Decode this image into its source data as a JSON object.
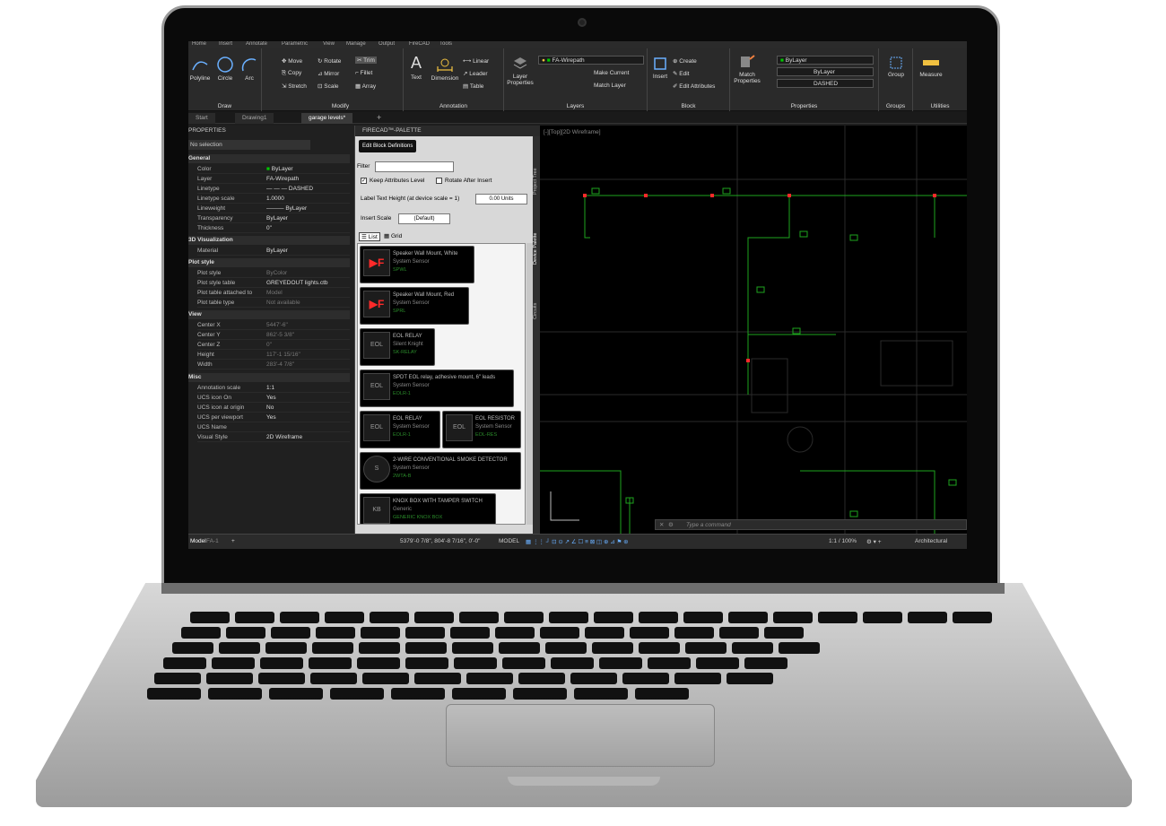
{
  "ribbon": {
    "tabs": [
      "Home",
      "Insert",
      "Annotate",
      "Parametric",
      "View",
      "Manage",
      "Output",
      "FireCAD",
      "Tools"
    ],
    "draw": {
      "label": "Draw",
      "polyline": "Polyline",
      "circle": "Circle",
      "arc": "Arc"
    },
    "modify": {
      "label": "Modify",
      "move": "Move",
      "rotate": "Rotate",
      "trim": "Trim",
      "copy": "Copy",
      "mirror": "Mirror",
      "fillet": "Fillet",
      "stretch": "Stretch",
      "scale": "Scale",
      "array": "Array"
    },
    "annotation": {
      "label": "Annotation",
      "text": "Text",
      "dimension": "Dimension",
      "linear": "Linear",
      "leader": "Leader",
      "table": "Table"
    },
    "layers": {
      "label": "Layers",
      "layer_properties": "Layer Properties",
      "current_layer": "FA-Wirepath",
      "make_current": "Make Current",
      "match_layer": "Match Layer"
    },
    "block": {
      "label": "Block",
      "insert": "Insert",
      "create": "Create",
      "edit": "Edit",
      "edit_attributes": "Edit Attributes"
    },
    "properties": {
      "label": "Properties",
      "match_properties": "Match Properties",
      "color": "ByLayer",
      "lineweight": "ByLayer",
      "linetype": "DASHED"
    },
    "groups": {
      "label": "Groups",
      "group": "Group"
    },
    "utilities": {
      "label": "Utilities",
      "measure": "Measure"
    }
  },
  "doc_tabs": [
    "Start",
    "Drawing1",
    "garage levels*"
  ],
  "props": {
    "title": "PROPERTIES",
    "selection": "No selection",
    "sections": {
      "general": "General",
      "viz": "3D Visualization",
      "plot": "Plot style",
      "view": "View",
      "misc": "Misc"
    },
    "general": [
      {
        "name": "Color",
        "value": "ByLayer"
      },
      {
        "name": "Layer",
        "value": "FA-Wirepath"
      },
      {
        "name": "Linetype",
        "value": "DASHED"
      },
      {
        "name": "Linetype scale",
        "value": "1.0000"
      },
      {
        "name": "Lineweight",
        "value": "ByLayer"
      },
      {
        "name": "Transparency",
        "value": "ByLayer"
      },
      {
        "name": "Thickness",
        "value": "0\""
      }
    ],
    "viz": [
      {
        "name": "Material",
        "value": "ByLayer"
      }
    ],
    "plot": [
      {
        "name": "Plot style",
        "value": "ByColor"
      },
      {
        "name": "Plot style table",
        "value": "GREYEDOUT lights.ctb"
      },
      {
        "name": "Plot table attached to",
        "value": "Model"
      },
      {
        "name": "Plot table type",
        "value": "Not available"
      }
    ],
    "view": [
      {
        "name": "Center X",
        "value": "5447'-6\""
      },
      {
        "name": "Center Y",
        "value": "862'-5 3/8\""
      },
      {
        "name": "Center Z",
        "value": "0\""
      },
      {
        "name": "Height",
        "value": "117'-1 15/16\""
      },
      {
        "name": "Width",
        "value": "283'-4 7/8\""
      }
    ],
    "misc": [
      {
        "name": "Annotation scale",
        "value": "1:1"
      },
      {
        "name": "UCS icon On",
        "value": "Yes"
      },
      {
        "name": "UCS icon at origin",
        "value": "No"
      },
      {
        "name": "UCS per viewport",
        "value": "Yes"
      },
      {
        "name": "UCS Name",
        "value": ""
      },
      {
        "name": "Visual Style",
        "value": "2D Wireframe"
      }
    ]
  },
  "palette": {
    "title": "FIRECAD™-PALETTE",
    "edit_block_definitions": "Edit Block Definitions",
    "filter_label": "Filter",
    "filter_value": "",
    "keep_attributes": "Keep Attributes Level",
    "rotate_after_insert": "Rotate After Insert",
    "label_text_height": "Label Text Height  (at device scale = 1)",
    "label_text_value": "0.00 Units",
    "insert_scale": "Insert Scale",
    "insert_scale_value": "(Default)",
    "view_list": "List",
    "view_grid": "Grid",
    "side_tabs": [
      "Project Tree",
      "Device Palette",
      "Circuits"
    ],
    "blocks": [
      {
        "icon": "F",
        "name": "Speaker Wall Mount, White",
        "category": "System Sensor",
        "code": "SPWL"
      },
      {
        "icon": "F",
        "name": "Speaker Wall Mount, Red",
        "category": "System Sensor",
        "code": "SPRL"
      },
      {
        "icon": "EOL",
        "name": "EOL RELAY",
        "category": "Silent Knight",
        "code": "SK-RELAY"
      },
      {
        "icon": "EOL",
        "name": "SPDT EOL relay, adhesive mount, 6\" leads",
        "category": "System Sensor",
        "code": "EOLR-1"
      },
      {
        "icon": "EOL",
        "name": "EOL RELAY",
        "category": "System Sensor",
        "code": "EOLR-1"
      },
      {
        "icon": "EOL",
        "name": "EOL RESISTOR",
        "category": "System Sensor",
        "code": "EOL-RES"
      },
      {
        "icon": "S",
        "name": "2-WIRE CONVENTIONAL SMOKE DETECTOR",
        "category": "System Sensor",
        "code": "2WTA-B"
      },
      {
        "icon": "KB",
        "name": "KNOX BOX WITH TAMPER SWITCH",
        "category": "Generic",
        "code": "GENERIC KNOX BOX"
      }
    ]
  },
  "viewport": {
    "label": "[-][Top][2D Wireframe]"
  },
  "command": {
    "placeholder": "Type a command"
  },
  "layout_tabs": [
    "Model",
    "FA-1"
  ],
  "status": {
    "coords": "5379'-0 7/8\", 804'-8 7/16\", 0'-0\"",
    "model": "MODEL",
    "scale": "1:1 / 100%",
    "units": "Architectural"
  },
  "colors": {
    "accent_green": "#00c800",
    "accent_red": "#ff2a2a",
    "wire_green": "#1ea51e"
  }
}
